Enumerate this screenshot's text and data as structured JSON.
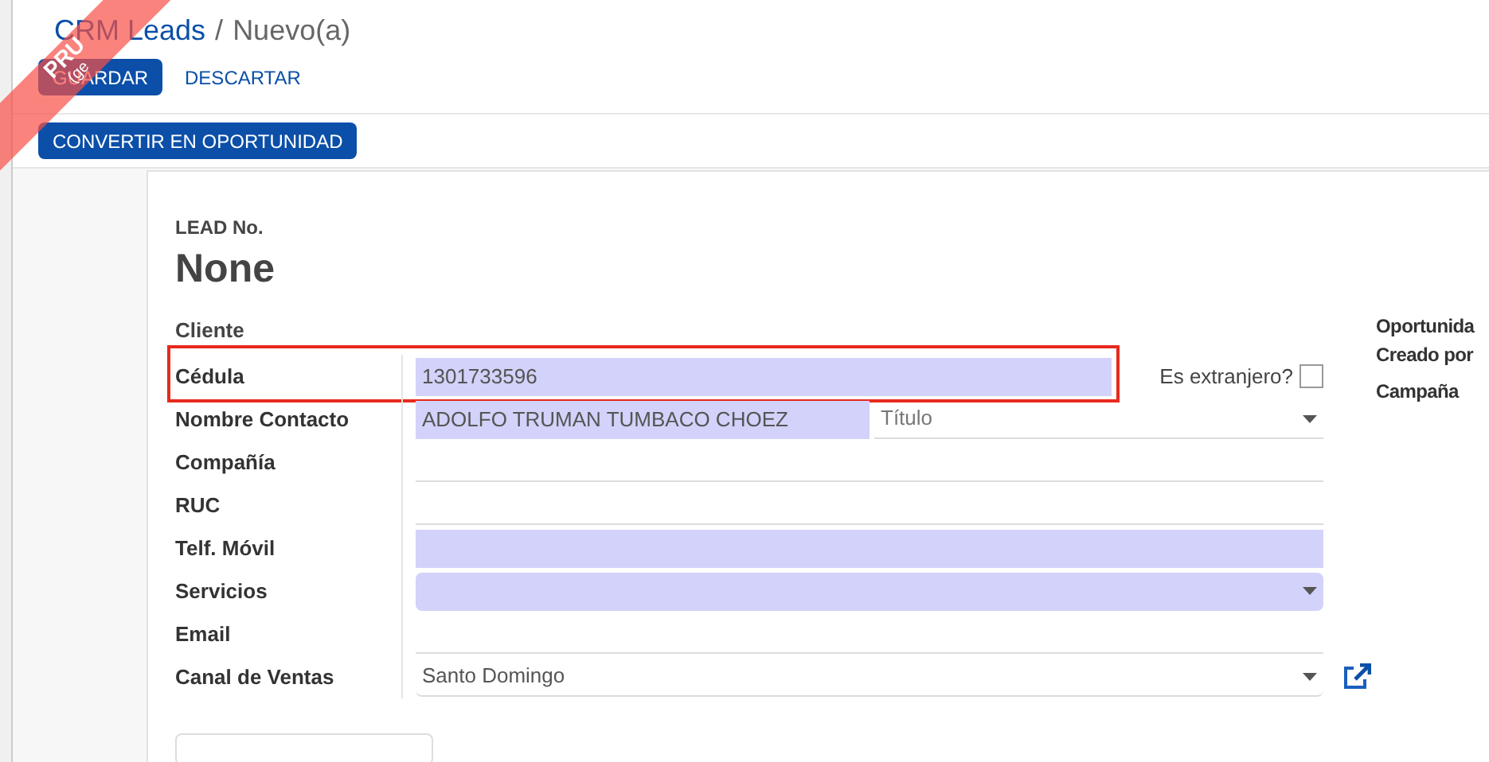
{
  "ribbon": {
    "text": "PRU",
    "subtext": "(ge"
  },
  "breadcrumb": {
    "parent": "CRM Leads",
    "separator": "/",
    "current": "Nuevo(a)"
  },
  "actions": {
    "save": "GUARDAR",
    "discard": "DESCARTAR"
  },
  "status_buttons": [
    "CONVERTIR EN OPORTUNIDAD"
  ],
  "sheet": {
    "number_label": "LEAD No.",
    "number": "None",
    "section": "Cliente",
    "fields": [
      {
        "label": "Cédula",
        "kind": "text",
        "value": "1301733596",
        "required": true,
        "highlighted": true,
        "checkbox": {
          "label": "Es extranjero?",
          "checked": false
        }
      },
      {
        "label": "Nombre Contacto",
        "kind": "text",
        "value": "ADOLFO TRUMAN TUMBACO CHOEZ",
        "required": true,
        "title_select": {
          "placeholder": "Título"
        }
      },
      {
        "label": "Compañía",
        "kind": "text",
        "required": false
      },
      {
        "label": "RUC",
        "kind": "text",
        "required": false
      },
      {
        "label": "Telf. Móvil",
        "kind": "text",
        "required": true
      },
      {
        "label": "Servicios",
        "kind": "select",
        "required": true
      },
      {
        "label": "Email",
        "kind": "text",
        "required": false
      },
      {
        "label": "Canal de Ventas",
        "kind": "select",
        "value": "Santo Domingo",
        "required": false,
        "external_link": true
      }
    ],
    "right_labels": [
      "Oportunida",
      "Creado por",
      "Campaña"
    ]
  }
}
